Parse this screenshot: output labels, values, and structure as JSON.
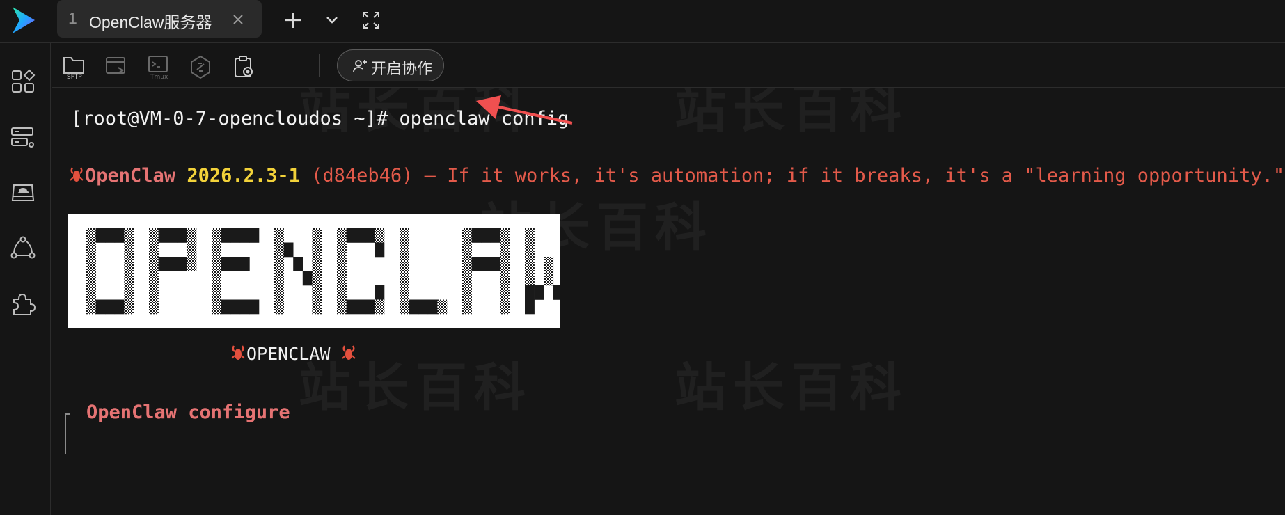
{
  "window": {
    "logo": "app-logo",
    "tab": {
      "index": "1",
      "title": "OpenClaw服务器",
      "close_icon": "close-icon"
    },
    "top_buttons": [
      "plus-icon",
      "chevron-down-icon",
      "fullscreen-icon"
    ]
  },
  "sidebar": {
    "items": [
      {
        "icon": "apps-grid-icon"
      },
      {
        "icon": "server-list-icon"
      },
      {
        "icon": "cloud-drive-icon"
      },
      {
        "icon": "share-nodes-icon"
      },
      {
        "icon": "plugin-icon"
      }
    ]
  },
  "toolbar": {
    "sftp_label": "SFTP",
    "tmux_label": "Tmux",
    "tools": [
      "sftp-icon",
      "window-icon",
      "tmux-icon",
      "link-icon",
      "clipboard-record-icon"
    ],
    "collab_label": "开启协作",
    "collab_icon": "add-user-icon"
  },
  "terminal": {
    "prompt": "[root@VM-0-7-opencloudos ~]# ",
    "command": "openclaw config",
    "banner": {
      "name": "OpenClaw",
      "version": "2026.2.3-1",
      "rest": " (d84eb46) — If it works, it's automation; if it breaks, it's a \"learning opportunity.\""
    },
    "logo_text": "OPENCLAW",
    "sublogo": "OPENCLAW",
    "config_title": "OpenClaw configure"
  },
  "watermark": "站长百科",
  "colors": {
    "background": "#151515",
    "accent_red": "#e57373",
    "version_yellow": "#f2d23a",
    "tagline_red": "#e35a4a",
    "arrow_red": "#f05050"
  }
}
